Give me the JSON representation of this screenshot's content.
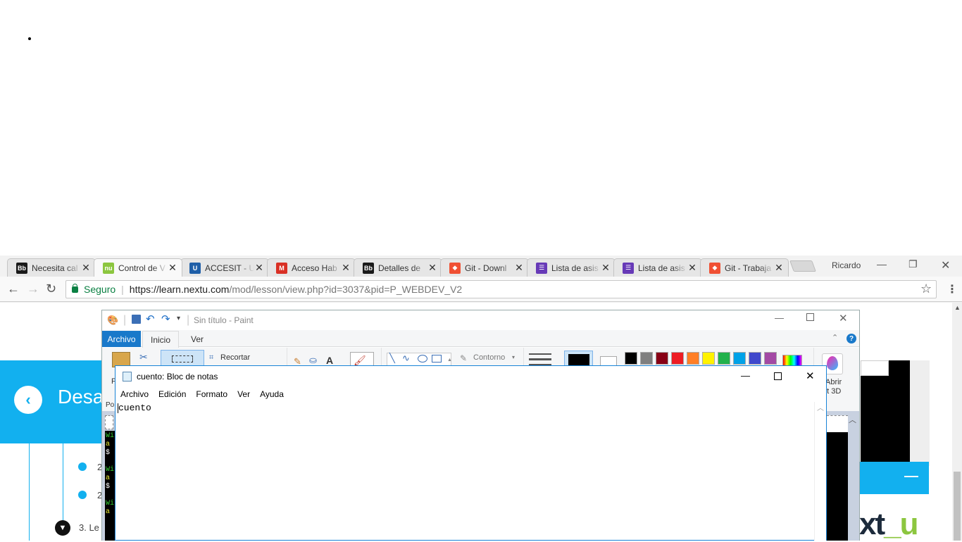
{
  "browser": {
    "tabs": [
      {
        "label": "Necesita cal",
        "icon": "blackboard-icon",
        "color": "#1a1a1a",
        "glyph": "Bb"
      },
      {
        "label": "Control de V",
        "icon": "nextu-icon",
        "color": "#8cc63f",
        "glyph": "nu",
        "active": true
      },
      {
        "label": "ACCESIT - U",
        "icon": "university-icon",
        "color": "#1f5fa8",
        "glyph": "U"
      },
      {
        "label": "Acceso Hab",
        "icon": "gmail-icon",
        "color": "#d93025",
        "glyph": "M"
      },
      {
        "label": "Detalles de",
        "icon": "blackboard-icon",
        "color": "#1a1a1a",
        "glyph": "Bb"
      },
      {
        "label": "Git - Downl",
        "icon": "git-icon",
        "color": "#f05033",
        "glyph": "◆"
      },
      {
        "label": "Lista de asis",
        "icon": "forms-icon",
        "color": "#673ab7",
        "glyph": "☰"
      },
      {
        "label": "Lista de asis",
        "icon": "forms-icon",
        "color": "#673ab7",
        "glyph": "☰"
      },
      {
        "label": "Git - Trabaja",
        "icon": "git-icon",
        "color": "#f05033",
        "glyph": "◆"
      }
    ],
    "profile": "Ricardo",
    "secure_label": "Seguro",
    "url_host": "https://learn.nextu.com",
    "url_path": "/mod/lesson/view.php?id=3037&pid=P_WEBDEV_V2"
  },
  "page": {
    "banner_text": "Desa",
    "items": [
      {
        "label": "2"
      },
      {
        "label": "2"
      },
      {
        "label": "3. Le"
      }
    ],
    "brand": "xt",
    "brand_u": "_u"
  },
  "paint": {
    "title": "Sin título - Paint",
    "tabs": {
      "archivo": "Archivo",
      "inicio": "Inicio",
      "ver": "Ver"
    },
    "recortar": "Recortar",
    "contorno": "Contorno",
    "abrir": "Abrir",
    "paint3d": "nt 3D",
    "pegar_partial": "P",
    "po_partial": "Po",
    "palette": [
      "#000000",
      "#7f7f7f",
      "#880015",
      "#ed1c24",
      "#ff7f27",
      "#fff200",
      "#22b14c",
      "#00a2e8",
      "#3f48cc",
      "#a349a4"
    ]
  },
  "notepad": {
    "title": "cuento: Bloc de notas",
    "menu": [
      "Archivo",
      "Edición",
      "Formato",
      "Ver",
      "Ayuda"
    ],
    "content": "cuento"
  }
}
